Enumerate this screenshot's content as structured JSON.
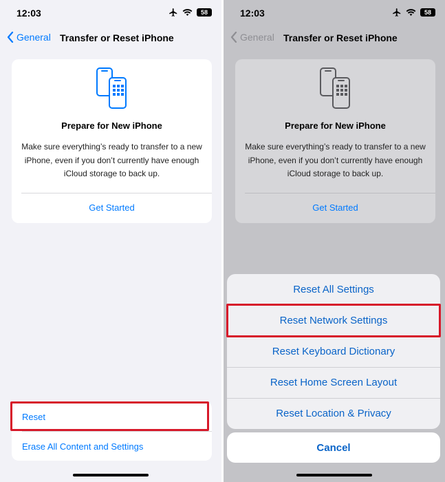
{
  "status": {
    "time": "12:03",
    "battery": "58"
  },
  "nav": {
    "back_label": "General",
    "title": "Transfer or Reset iPhone"
  },
  "card": {
    "title": "Prepare for New iPhone",
    "description": "Make sure everything’s ready to transfer to a new iPhone, even if you don’t currently have enough iCloud storage to back up.",
    "link": "Get Started"
  },
  "list": {
    "reset": "Reset",
    "erase": "Erase All Content and Settings"
  },
  "sheet": {
    "options": [
      "Reset All Settings",
      "Reset Network Settings",
      "Reset Keyboard Dictionary",
      "Reset Home Screen Layout",
      "Reset Location & Privacy"
    ],
    "cancel": "Cancel"
  },
  "colors": {
    "accent": "#007aff",
    "highlight": "#d7192a"
  }
}
